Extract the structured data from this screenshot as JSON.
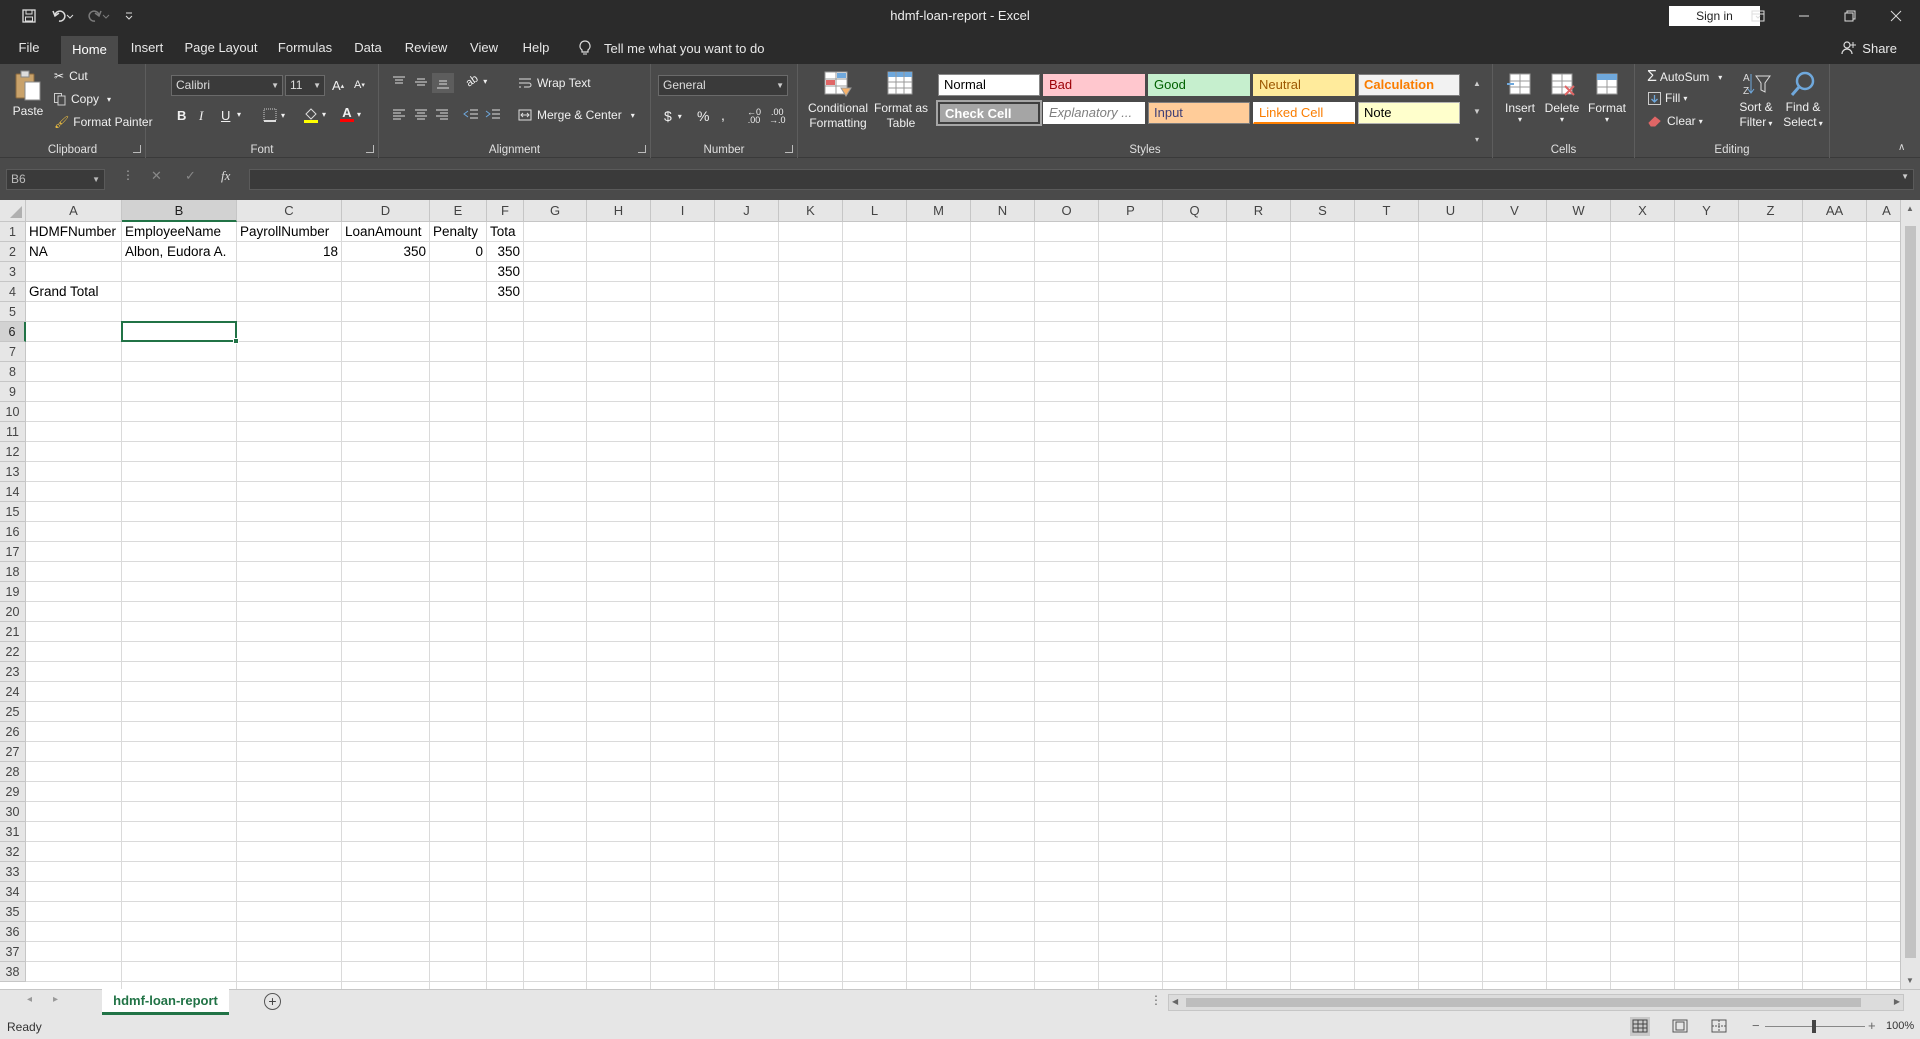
{
  "window": {
    "title": "hdmf-loan-report  -  Excel",
    "sign_in": "Sign in",
    "share": "Share"
  },
  "menu": {
    "tabs": [
      "File",
      "Home",
      "Insert",
      "Page Layout",
      "Formulas",
      "Data",
      "Review",
      "View",
      "Help"
    ],
    "active_tab": "Home",
    "tell_me": "Tell me what you want to do"
  },
  "ribbon": {
    "clipboard": {
      "label": "Clipboard",
      "paste": "Paste",
      "cut": "Cut",
      "copy": "Copy",
      "format_painter": "Format Painter"
    },
    "font": {
      "label": "Font",
      "name": "Calibri",
      "size": "11",
      "bold": "B",
      "italic": "I",
      "underline": "U"
    },
    "alignment": {
      "label": "Alignment",
      "wrap_text": "Wrap Text",
      "merge_center": "Merge & Center"
    },
    "number": {
      "label": "Number",
      "format": "General"
    },
    "styles": {
      "label": "Styles",
      "conditional_formatting_1": "Conditional",
      "conditional_formatting_2": "Formatting",
      "format_as_table_1": "Format as",
      "format_as_table_2": "Table",
      "cells": [
        {
          "name": "Normal",
          "bg": "#ffffff",
          "fg": "#000000",
          "border": "#888888"
        },
        {
          "name": "Bad",
          "bg": "#ffc7ce",
          "fg": "#9c0006",
          "border": "#ffc7ce"
        },
        {
          "name": "Good",
          "bg": "#c6efce",
          "fg": "#006100",
          "border": "#c6efce"
        },
        {
          "name": "Neutral",
          "bg": "#ffeb9c",
          "fg": "#9c5700",
          "border": "#ffeb9c"
        },
        {
          "name": "Calculation",
          "bg": "#f2f2f2",
          "fg": "#fa7d00",
          "border": "#7f7f7f"
        },
        {
          "name": "Check Cell",
          "bg": "#a5a5a5",
          "fg": "#ffffff",
          "border": "#3f3f3f"
        },
        {
          "name": "Explanatory ...",
          "bg": "#ffffff",
          "fg": "#7f7f7f",
          "border": "#ffffff"
        },
        {
          "name": "Input",
          "bg": "#ffcc99",
          "fg": "#3f3f76",
          "border": "#7f7f7f"
        },
        {
          "name": "Linked Cell",
          "bg": "#ffffff",
          "fg": "#fa7d00",
          "border": "#ffffff"
        },
        {
          "name": "Note",
          "bg": "#ffffcc",
          "fg": "#000000",
          "border": "#b2b2b2"
        }
      ]
    },
    "cells": {
      "label": "Cells",
      "insert": "Insert",
      "delete": "Delete",
      "format": "Format"
    },
    "editing": {
      "label": "Editing",
      "autosum": "AutoSum",
      "fill": "Fill",
      "clear": "Clear",
      "sort_filter_1": "Sort &",
      "sort_filter_2": "Filter",
      "find_select_1": "Find &",
      "find_select_2": "Select"
    }
  },
  "formula_bar": {
    "name_box": "B6",
    "cancel": "✕",
    "enter": "✓",
    "fx": "fx",
    "content": ""
  },
  "sheet": {
    "columns": [
      "A",
      "B",
      "C",
      "D",
      "E",
      "F",
      "G",
      "H",
      "I",
      "J",
      "K",
      "L",
      "M",
      "N",
      "O",
      "P",
      "Q",
      "R",
      "S",
      "T",
      "U",
      "V",
      "W",
      "X",
      "Y",
      "Z",
      "AA",
      "A"
    ],
    "rows": [
      "1",
      "2",
      "3",
      "4",
      "5",
      "6",
      "7",
      "8",
      "9",
      "10",
      "11",
      "12",
      "13",
      "14",
      "15",
      "16",
      "17",
      "18",
      "19",
      "20",
      "21",
      "22",
      "23",
      "24",
      "25",
      "26",
      "27",
      "28",
      "29",
      "30",
      "31",
      "32",
      "33",
      "34",
      "35",
      "36",
      "37",
      "38"
    ],
    "selected_cell": "B6",
    "cells": [
      {
        "ref": "A1",
        "value": "HDMFNumber",
        "align": "left"
      },
      {
        "ref": "B1",
        "value": "EmployeeName",
        "align": "left"
      },
      {
        "ref": "C1",
        "value": "PayrollNumber",
        "align": "left"
      },
      {
        "ref": "D1",
        "value": "LoanAmount",
        "align": "left"
      },
      {
        "ref": "E1",
        "value": "Penalty",
        "align": "left"
      },
      {
        "ref": "F1",
        "value": "Tota",
        "align": "left"
      },
      {
        "ref": "A2",
        "value": "NA",
        "align": "left"
      },
      {
        "ref": "B2",
        "value": "Albon, Eudora A.",
        "align": "left"
      },
      {
        "ref": "C2",
        "value": "18",
        "align": "right"
      },
      {
        "ref": "D2",
        "value": "350",
        "align": "right"
      },
      {
        "ref": "E2",
        "value": "0",
        "align": "right"
      },
      {
        "ref": "F2",
        "value": "350",
        "align": "right"
      },
      {
        "ref": "F3",
        "value": "350",
        "align": "right"
      },
      {
        "ref": "A4",
        "value": "Grand Total",
        "align": "left"
      },
      {
        "ref": "F4",
        "value": "350",
        "align": "right"
      }
    ]
  },
  "sheet_tabs": {
    "active": "hdmf-loan-report"
  },
  "status": {
    "ready": "Ready",
    "zoom": "100%"
  }
}
